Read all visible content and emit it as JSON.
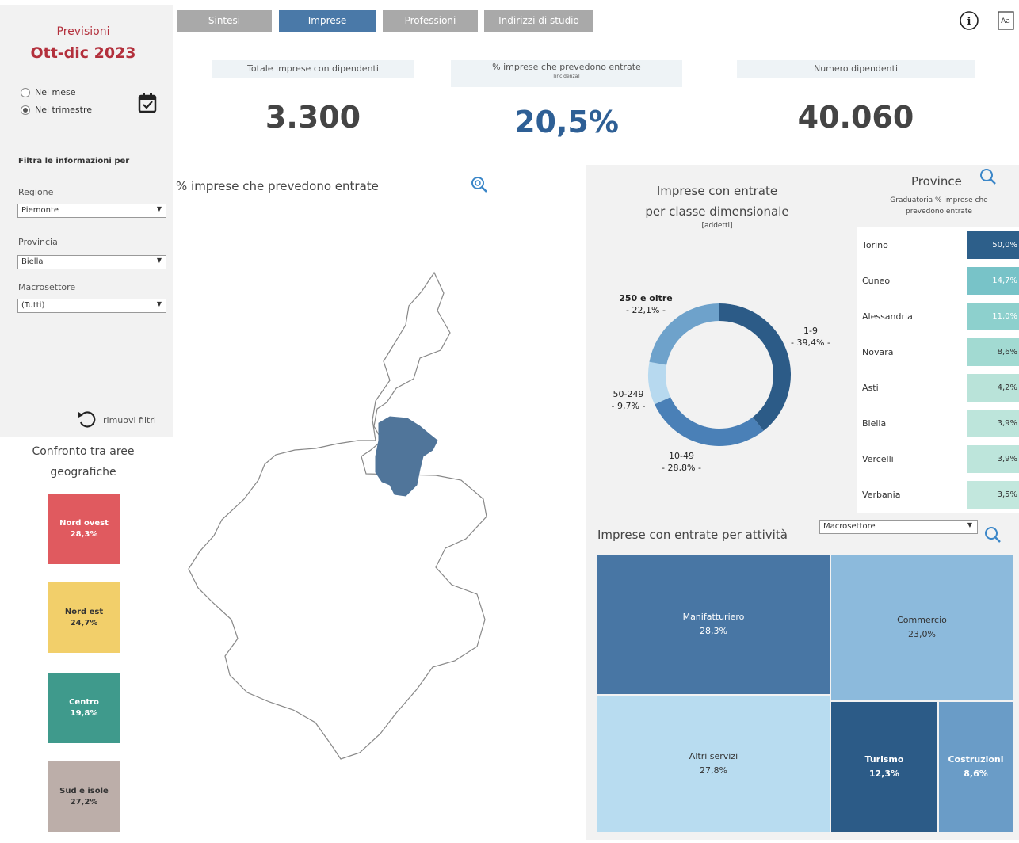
{
  "header": {
    "title_line1": "Previsioni",
    "title_line2": "Ott-dic 2023",
    "period_options": [
      "Nel mese",
      "Nel trimestre"
    ],
    "period_selected": "Nel trimestre"
  },
  "filters": {
    "title": "Filtra le informazioni per",
    "regione": {
      "label": "Regione",
      "value": "Piemonte"
    },
    "provincia": {
      "label": "Provincia",
      "value": "Biella"
    },
    "macrosettore": {
      "label": "Macrosettore",
      "value": "(Tutti)"
    },
    "reset_label": "rimuovi filtri"
  },
  "tabs": [
    {
      "label": "Sintesi",
      "active": false
    },
    {
      "label": "Imprese",
      "active": true
    },
    {
      "label": "Professioni",
      "active": false
    },
    {
      "label": "Indirizzi di studio",
      "active": false
    }
  ],
  "kpis": [
    {
      "label": "Totale imprese con dipendenti",
      "sub": "",
      "value": "3.300",
      "color": "#444444"
    },
    {
      "label": "% imprese che prevedono entrate",
      "sub": "[incidenza]",
      "value": "20,5%",
      "color": "#2e5f95"
    },
    {
      "label": "Numero dipendenti",
      "sub": "",
      "value": "40.060",
      "color": "#444444"
    }
  ],
  "map": {
    "title": "% imprese che prevedono entrate"
  },
  "confronto": {
    "title_line1": "Confronto tra aree",
    "title_line2": "geografiche",
    "areas": [
      {
        "name": "Nord ovest",
        "value": "28,3%",
        "color": "#e05a5f",
        "text_color": "#ffffff"
      },
      {
        "name": "Nord est",
        "value": "24,7%",
        "color": "#f2cf6a",
        "text_color": "#333333"
      },
      {
        "name": "Centro",
        "value": "19,8%",
        "color": "#3f9a8c",
        "text_color": "#ffffff"
      },
      {
        "name": "Sud e isole",
        "value": "27,2%",
        "color": "#bcaea9",
        "text_color": "#333333"
      }
    ]
  },
  "donut": {
    "title_line1": "Imprese con entrate",
    "title_line2": "per classe dimensionale",
    "subtitle": "[addetti]",
    "slices": [
      {
        "name": "1-9",
        "label": "- 39,4% -",
        "value": 39.4,
        "color": "#2c5b87"
      },
      {
        "name": "10-49",
        "label": "- 28,8% -",
        "value": 28.8,
        "color": "#4a80b7"
      },
      {
        "name": "50-249",
        "label": "- 9,7% -",
        "value": 9.7,
        "color": "#b7d9ef"
      },
      {
        "name": "250 e oltre",
        "label": "- 22,1% -",
        "value": 22.1,
        "color": "#6ea2cb"
      }
    ]
  },
  "province": {
    "title": "Province",
    "subtitle_line1": "Graduatoria % imprese che",
    "subtitle_line2": "prevedono entrate",
    "rows": [
      {
        "name": "Torino",
        "value": "50,0%",
        "bg": "#2d5f8a",
        "fg": "#ffffff"
      },
      {
        "name": "Cuneo",
        "value": "14,7%",
        "bg": "#78c3c8",
        "fg": "#ffffff"
      },
      {
        "name": "Alessandria",
        "value": "11,0%",
        "bg": "#8dd0cd",
        "fg": "#ffffff"
      },
      {
        "name": "Novara",
        "value": "8,6%",
        "bg": "#a2dad2",
        "fg": "#333333"
      },
      {
        "name": "Asti",
        "value": "4,2%",
        "bg": "#b9e3d9",
        "fg": "#333333"
      },
      {
        "name": "Biella",
        "value": "3,9%",
        "bg": "#bde5db",
        "fg": "#333333"
      },
      {
        "name": "Vercelli",
        "value": "3,9%",
        "bg": "#bde5db",
        "fg": "#333333"
      },
      {
        "name": "Verbania",
        "value": "3,5%",
        "bg": "#c2e7dd",
        "fg": "#333333"
      }
    ]
  },
  "attivita": {
    "title": "Imprese con entrate per attività",
    "select_value": "Macrosettore",
    "blocks": [
      {
        "name": "Manifatturiero",
        "value": "28,3%",
        "color": "#4876a4",
        "fg": "#ffffff"
      },
      {
        "name": "Commercio",
        "value": "23,0%",
        "color": "#8cbadc",
        "fg": "#333333"
      },
      {
        "name": "Altri servizi",
        "value": "27,8%",
        "color": "#b8dcf0",
        "fg": "#333333"
      },
      {
        "name": "Turismo",
        "value": "12,3%",
        "color": "#2c5b87",
        "fg": "#ffffff"
      },
      {
        "name": "Costruzioni",
        "value": "8,6%",
        "color": "#6a9cc7",
        "fg": "#ffffff"
      }
    ]
  },
  "icons": [
    "info-icon",
    "text-size-icon",
    "calendar-check-icon",
    "reset-icon",
    "zoom-icon",
    "search-icon"
  ]
}
